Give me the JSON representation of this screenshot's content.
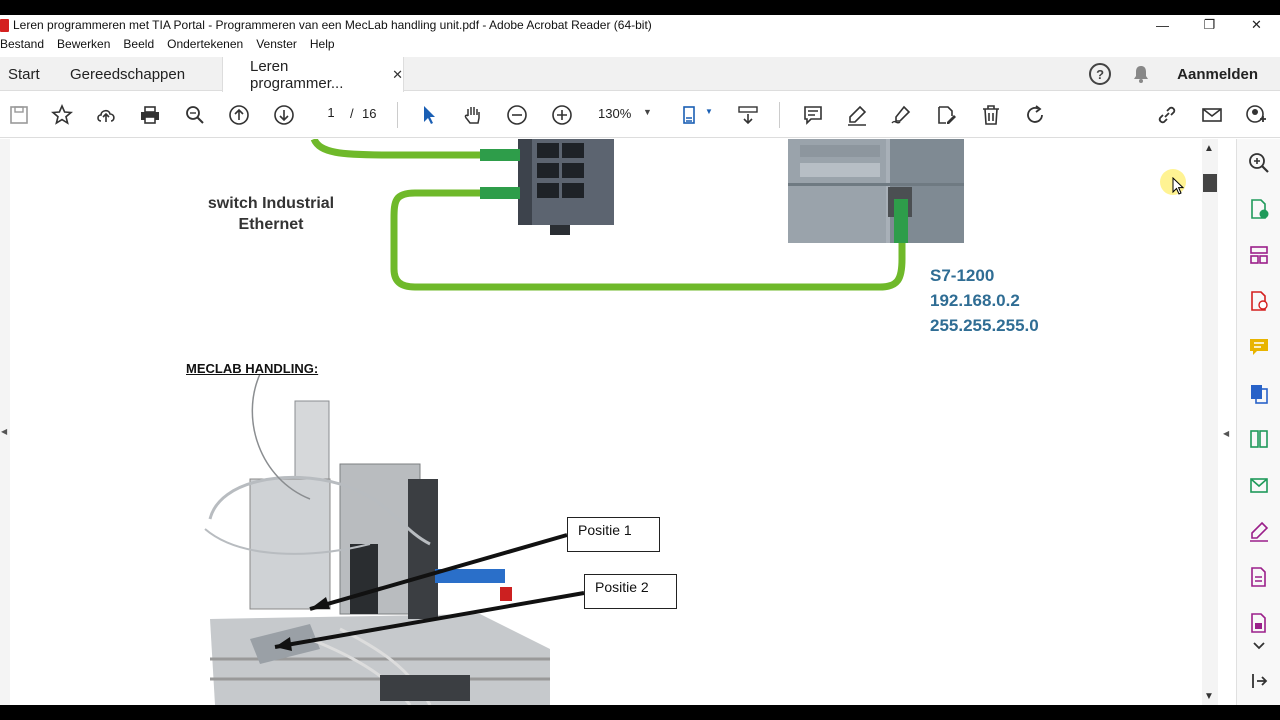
{
  "window": {
    "title": "Leren programmeren met TIA Portal - Programmeren van een MecLab handling unit.pdf - Adobe Acrobat Reader (64-bit)",
    "controls": {
      "minimize": "—",
      "restore": "❐",
      "close": "✕"
    }
  },
  "menu": [
    "Bestand",
    "Bewerken",
    "Beeld",
    "Ondertekenen",
    "Venster",
    "Help"
  ],
  "tabs": {
    "start": "Start",
    "tools": "Gereedschappen",
    "document": "Leren programmer...",
    "close": "✕"
  },
  "header": {
    "help": "?",
    "signin": "Aanmelden"
  },
  "toolbar": {
    "page_current": "1",
    "page_separator": "/",
    "page_total": "16",
    "zoom": "130%"
  },
  "document": {
    "switch_label_line1": "switch Industrial",
    "switch_label_line2": "Ethernet",
    "plc_name": "S7-1200",
    "plc_ip": "192.168.0.2",
    "plc_mask": "255.255.255.0",
    "section_title": "MECLAB HANDLING:",
    "position1": "Positie 1",
    "position2": "Positie 2"
  },
  "colors": {
    "cable": "#6fb92a",
    "plc_text": "#2f6d94",
    "acrobat_red": "#d4201f",
    "panel_purple": "#9b1f8a",
    "panel_blue": "#2862c8",
    "panel_green": "#1f9a5a",
    "panel_yellow": "#e8b400"
  },
  "icons": {
    "save": "save-icon",
    "star": "star-icon",
    "upload": "upload-icon",
    "print": "print-icon",
    "search": "search-icon",
    "prev": "arrow-up-icon",
    "next": "arrow-down-icon",
    "zoom_out": "zoom-out-icon",
    "zoom_in": "zoom-in-icon"
  }
}
